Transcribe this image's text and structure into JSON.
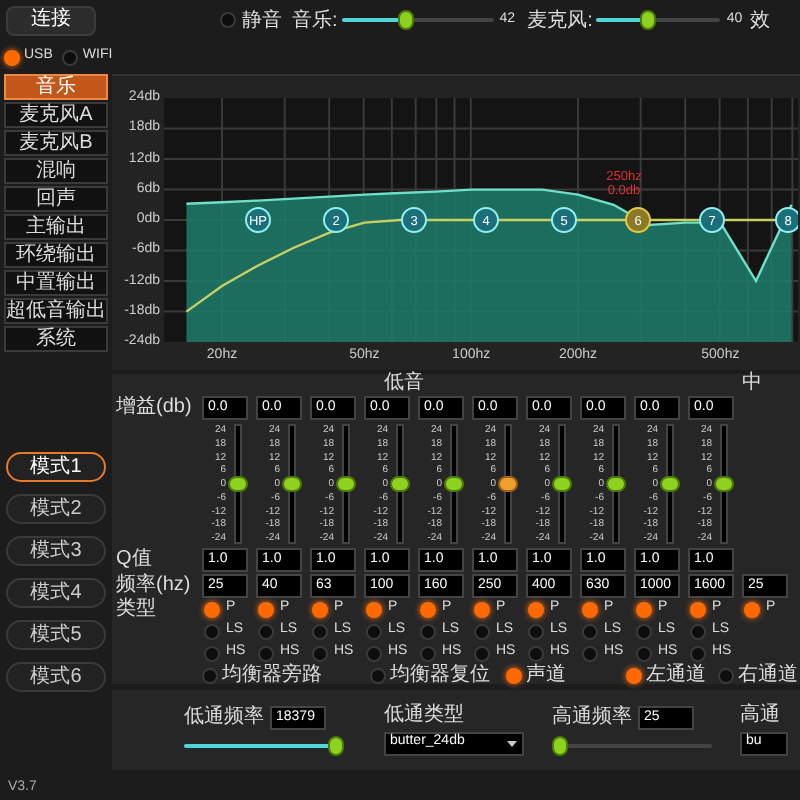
{
  "top_bar": {
    "connect_button": "连接",
    "mute": {
      "label": "静音",
      "on": false
    },
    "music": {
      "label": "音乐:",
      "level": 0.42,
      "reading": "42"
    },
    "mic": {
      "label": "麦克风:",
      "level": 0.4,
      "reading": "40"
    },
    "cut_label": "效"
  },
  "connection": [
    {
      "label": "USB",
      "selected": true
    },
    {
      "label": "WIFI",
      "selected": false
    }
  ],
  "menu": [
    {
      "label": "音乐",
      "selected": true
    },
    {
      "label": "麦克风A",
      "selected": false
    },
    {
      "label": "麦克风B",
      "selected": false
    },
    {
      "label": "混响",
      "selected": false
    },
    {
      "label": "回声",
      "selected": false
    },
    {
      "label": "主输出",
      "selected": false
    },
    {
      "label": "环绕输出",
      "selected": false
    },
    {
      "label": "中置输出",
      "selected": false
    },
    {
      "label": "超低音输出",
      "selected": false
    },
    {
      "label": "系统",
      "selected": false
    }
  ],
  "modes": [
    {
      "label": "模式1",
      "selected": true
    },
    {
      "label": "模式2",
      "selected": false
    },
    {
      "label": "模式3",
      "selected": false
    },
    {
      "label": "模式4",
      "selected": false
    },
    {
      "label": "模式5",
      "selected": false
    },
    {
      "label": "模式6",
      "selected": false
    }
  ],
  "version": "V3.7",
  "eq_chart": {
    "chart_data": {
      "type": "line",
      "grid": true,
      "ylim": [
        -24,
        24
      ],
      "categories": [
        null,
        "20hz",
        null,
        null,
        null,
        "50hz",
        null,
        null,
        "100hz",
        null,
        null,
        "200hz",
        null,
        null,
        null,
        "500hz",
        null,
        null
      ],
      "yticks": [
        {
          "value": 24,
          "label": "24db"
        },
        {
          "value": 18,
          "label": "18db"
        },
        {
          "value": 12,
          "label": "12db"
        },
        {
          "value": 6,
          "label": "6db"
        },
        {
          "value": 0,
          "label": "0db"
        },
        {
          "value": -6,
          "label": "-6db"
        },
        {
          "value": -12,
          "label": "-12db"
        },
        {
          "value": -18,
          "label": "-18db"
        },
        {
          "value": -24,
          "label": "-24db"
        }
      ],
      "series": [
        {
          "color": "#6fe0c8",
          "values": [
            3.2,
            3.5,
            3.8,
            4.2,
            4.6,
            5,
            5.3,
            5.6,
            6,
            6,
            6,
            5,
            3,
            -1,
            -0.5,
            -0.5,
            -12,
            3
          ]
        },
        {
          "color": "#c8d060",
          "values": [
            -18,
            -13,
            -9,
            -5.5,
            -2.5,
            -0.5,
            0,
            0,
            0,
            0,
            0,
            0,
            0,
            0,
            0,
            0,
            0,
            0
          ]
        }
      ]
    },
    "markers": [
      {
        "label": "HP",
        "selected": false
      },
      {
        "label": "2",
        "selected": false
      },
      {
        "label": "3",
        "selected": false
      },
      {
        "label": "4",
        "selected": false
      },
      {
        "label": "5",
        "selected": false
      },
      {
        "label": "6",
        "selected": true
      },
      {
        "label": "7",
        "selected": false
      },
      {
        "label": "8",
        "selected": false
      }
    ],
    "readout": [
      "250hz",
      "0.0db"
    ]
  },
  "bands": {
    "header_left": "低音",
    "header_right": "中",
    "row_labels": {
      "gain": "增益(db)",
      "q": "Q值",
      "freq": "频率(hz)",
      "type": "类型"
    },
    "columns": [
      {
        "gain": "0.0",
        "scale": [
          "24",
          "18",
          "12",
          "6",
          "0",
          "-6",
          "-12",
          "-18",
          "-24"
        ],
        "level": 0.5,
        "selected": false,
        "q": "1.0",
        "freq": "25",
        "types": [
          {
            "label": "P",
            "selected": true
          },
          {
            "label": "LS",
            "selected": false
          },
          {
            "label": "HS",
            "selected": false
          }
        ]
      },
      {
        "gain": "0.0",
        "scale": [
          "24",
          "18",
          "12",
          "6",
          "0",
          "-6",
          "-12",
          "-18",
          "-24"
        ],
        "level": 0.5,
        "selected": false,
        "q": "1.0",
        "freq": "40",
        "types": [
          {
            "label": "P",
            "selected": true
          },
          {
            "label": "LS",
            "selected": false
          },
          {
            "label": "HS",
            "selected": false
          }
        ]
      },
      {
        "gain": "0.0",
        "scale": [
          "24",
          "18",
          "12",
          "6",
          "0",
          "-6",
          "-12",
          "-18",
          "-24"
        ],
        "level": 0.5,
        "selected": false,
        "q": "1.0",
        "freq": "63",
        "types": [
          {
            "label": "P",
            "selected": true
          },
          {
            "label": "LS",
            "selected": false
          },
          {
            "label": "HS",
            "selected": false
          }
        ]
      },
      {
        "gain": "0.0",
        "scale": [
          "24",
          "18",
          "12",
          "6",
          "0",
          "-6",
          "-12",
          "-18",
          "-24"
        ],
        "level": 0.5,
        "selected": false,
        "q": "1.0",
        "freq": "100",
        "types": [
          {
            "label": "P",
            "selected": true
          },
          {
            "label": "LS",
            "selected": false
          },
          {
            "label": "HS",
            "selected": false
          }
        ]
      },
      {
        "gain": "0.0",
        "scale": [
          "24",
          "18",
          "12",
          "6",
          "0",
          "-6",
          "-12",
          "-18",
          "-24"
        ],
        "level": 0.5,
        "selected": false,
        "q": "1.0",
        "freq": "160",
        "types": [
          {
            "label": "P",
            "selected": true
          },
          {
            "label": "LS",
            "selected": false
          },
          {
            "label": "HS",
            "selected": false
          }
        ]
      },
      {
        "gain": "0.0",
        "scale": [
          "24",
          "18",
          "12",
          "6",
          "0",
          "-6",
          "-12",
          "-18",
          "-24"
        ],
        "level": 0.5,
        "selected": true,
        "q": "1.0",
        "freq": "250",
        "types": [
          {
            "label": "P",
            "selected": true
          },
          {
            "label": "LS",
            "selected": false
          },
          {
            "label": "HS",
            "selected": false
          }
        ]
      },
      {
        "gain": "0.0",
        "scale": [
          "24",
          "18",
          "12",
          "6",
          "0",
          "-6",
          "-12",
          "-18",
          "-24"
        ],
        "level": 0.5,
        "selected": false,
        "q": "1.0",
        "freq": "400",
        "types": [
          {
            "label": "P",
            "selected": true
          },
          {
            "label": "LS",
            "selected": false
          },
          {
            "label": "HS",
            "selected": false
          }
        ]
      },
      {
        "gain": "0.0",
        "scale": [
          "24",
          "18",
          "12",
          "6",
          "0",
          "-6",
          "-12",
          "-18",
          "-24"
        ],
        "level": 0.5,
        "selected": false,
        "q": "1.0",
        "freq": "630",
        "types": [
          {
            "label": "P",
            "selected": true
          },
          {
            "label": "LS",
            "selected": false
          },
          {
            "label": "HS",
            "selected": false
          }
        ]
      },
      {
        "gain": "0.0",
        "scale": [
          "24",
          "18",
          "12",
          "6",
          "0",
          "-6",
          "-12",
          "-18",
          "-24"
        ],
        "level": 0.5,
        "selected": false,
        "q": "1.0",
        "freq": "1000",
        "types": [
          {
            "label": "P",
            "selected": true
          },
          {
            "label": "LS",
            "selected": false
          },
          {
            "label": "HS",
            "selected": false
          }
        ]
      },
      {
        "gain": "0.0",
        "scale": [
          "24",
          "18",
          "12",
          "6",
          "0",
          "-6",
          "-12",
          "-18",
          "-24"
        ],
        "level": 0.5,
        "selected": false,
        "q": "1.0",
        "freq": "1600",
        "types": [
          {
            "label": "P",
            "selected": true
          },
          {
            "label": "LS",
            "selected": false
          },
          {
            "label": "HS",
            "selected": false
          }
        ]
      },
      {
        "freq": "25",
        "types": [
          {
            "label": "P",
            "selected": true
          }
        ]
      }
    ],
    "options": [
      {
        "label": "均衡器旁路",
        "on": false
      },
      {
        "label": "均衡器复位",
        "on": false
      },
      {
        "label": "声道",
        "on": true
      },
      {
        "label": "左通道",
        "on": true
      },
      {
        "label": "右通道",
        "on": false
      }
    ]
  },
  "filters": {
    "low_pass_freq": {
      "label": "低通频率",
      "value": "18379",
      "level": 1
    },
    "low_pass_type": {
      "label": "低通类型",
      "value": "butter_24db"
    },
    "high_pass_freq": {
      "label": "高通频率",
      "value": "25",
      "level": 0
    },
    "high_pass_type": {
      "label": "高通",
      "value": "bu"
    }
  }
}
